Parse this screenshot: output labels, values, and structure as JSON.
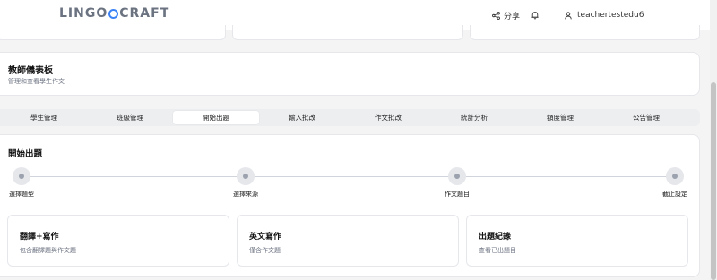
{
  "header": {
    "logo_left": "LINGO",
    "logo_right": "CRAFT",
    "share_label": "分享",
    "username": "teachertestedu6"
  },
  "dashboard": {
    "title": "教師儀表板",
    "subtitle": "管理和查看學生作文"
  },
  "tabs": [
    {
      "label": "學生管理",
      "active": false
    },
    {
      "label": "班級管理",
      "active": false
    },
    {
      "label": "開始出題",
      "active": true
    },
    {
      "label": "輸入批改",
      "active": false
    },
    {
      "label": "作文批改",
      "active": false
    },
    {
      "label": "統計分析",
      "active": false
    },
    {
      "label": "額度管理",
      "active": false
    },
    {
      "label": "公告管理",
      "active": false
    }
  ],
  "main": {
    "title": "開始出題",
    "steps": [
      {
        "label": "選擇題型"
      },
      {
        "label": "選擇來源"
      },
      {
        "label": "作文題目"
      },
      {
        "label": "截止設定"
      }
    ],
    "options": [
      {
        "title": "翻譯+寫作",
        "desc": "包含翻譯題與作文題"
      },
      {
        "title": "英文寫作",
        "desc": "僅含作文題"
      },
      {
        "title": "出題紀錄",
        "desc": "查看已出題目"
      }
    ]
  },
  "colors": {
    "accent": "#3b82f6",
    "muted_text": "#6b7280",
    "tab_bar": "#eceef0"
  },
  "icons": {
    "share": "share-icon",
    "bell": "bell-icon",
    "user": "user-icon"
  }
}
